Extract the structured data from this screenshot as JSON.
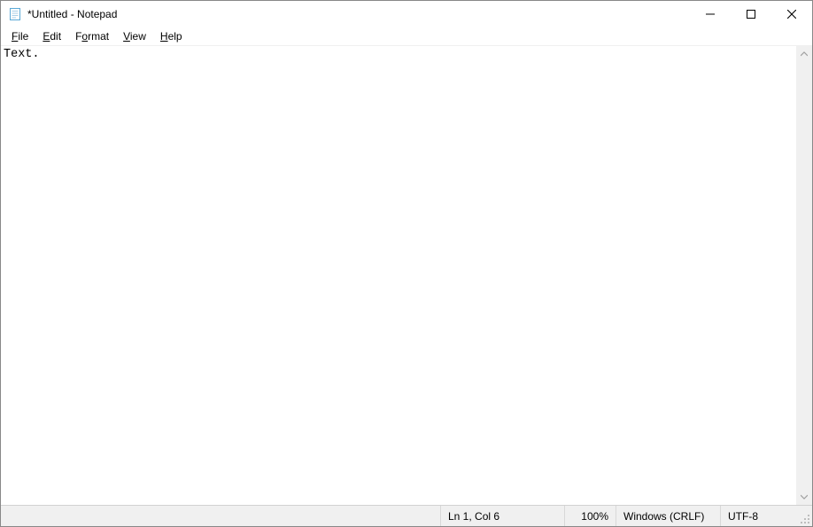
{
  "title": "*Untitled - Notepad",
  "menu": {
    "file": "File",
    "edit": "Edit",
    "format": "Format",
    "view": "View",
    "help": "Help"
  },
  "editor": {
    "content": "Text."
  },
  "statusbar": {
    "cursor": "Ln 1, Col 6",
    "zoom": "100%",
    "eol": "Windows (CRLF)",
    "encoding": "UTF-8"
  }
}
